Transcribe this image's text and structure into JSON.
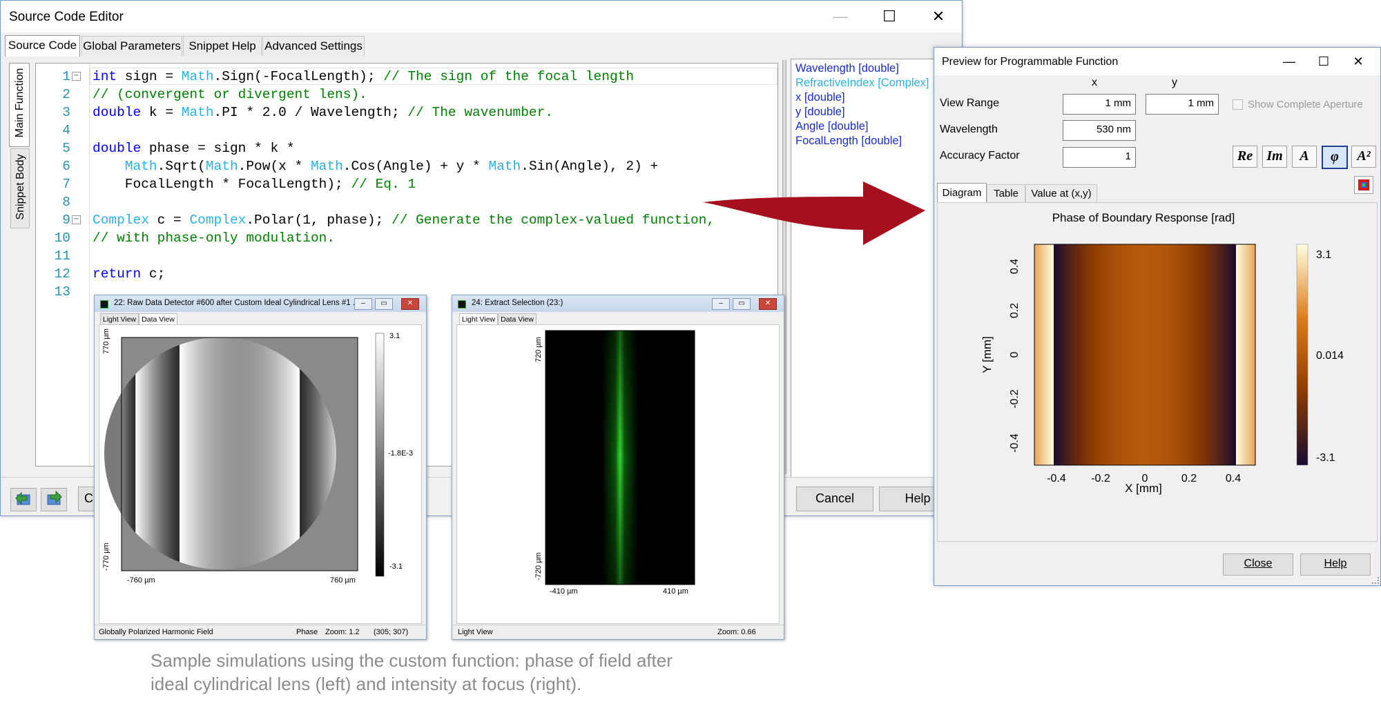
{
  "editor": {
    "title": "Source Code Editor",
    "tabs": [
      "Source Code",
      "Global Parameters",
      "Snippet Help",
      "Advanced Settings"
    ],
    "side_tabs": [
      "Main Function",
      "Snippet Body"
    ],
    "line_numbers": [
      "1",
      "2",
      "3",
      "4",
      "5",
      "6",
      "7",
      "8",
      "9",
      "10",
      "11",
      "12",
      "13"
    ],
    "code": {
      "l1": {
        "kw1": "int",
        "t1": " sign = ",
        "c1": "Math",
        "t2": ".Sign(-FocalLength); ",
        "cm": "// The sign of the focal length"
      },
      "l2": {
        "cm": "// (convergent or divergent lens)."
      },
      "l3": {
        "kw1": "double",
        "t1": " k = ",
        "c1": "Math",
        "t2": ".PI * 2.0 / Wavelength; ",
        "cm": "// The wavenumber."
      },
      "l5": {
        "kw1": "double",
        "t1": " phase = sign * k *"
      },
      "l6": {
        "t0": "    ",
        "c1": "Math",
        "t1": ".Sqrt(",
        "c2": "Math",
        "t2": ".Pow(x * ",
        "c3": "Math",
        "t3": ".Cos(Angle) + y * ",
        "c4": "Math",
        "t4": ".Sin(Angle), 2) +"
      },
      "l7": {
        "t1": "    FocalLength * FocalLength); ",
        "cm": "// Eq. 1"
      },
      "l9": {
        "c1": "Complex",
        "t1": " c = ",
        "c2": "Complex",
        "t2": ".Polar(1, phase); ",
        "cm": "// Generate the complex-valued function,"
      },
      "l10": {
        "cm": "// with phase-only modulation."
      },
      "l12": {
        "kw1": "return",
        "t1": " c;"
      }
    },
    "parameters": [
      "Wavelength [double]",
      "RefractiveIndex [Complex]",
      "x [double]",
      "y [double]",
      "Angle [double]",
      "FocalLength [double]"
    ],
    "cancel_label": "Cancel",
    "help_label": "Help",
    "partial_button_label": "C"
  },
  "preview": {
    "title": "Preview for Programmable Function",
    "col_x": "x",
    "col_y": "y",
    "view_range_label": "View Range",
    "view_range_x": "1 mm",
    "view_range_y": "1 mm",
    "show_complete_aperture": "Show Complete Aperture",
    "wavelength_label": "Wavelength",
    "wavelength_value": "530 nm",
    "accuracy_label": "Accuracy Factor",
    "accuracy_value": "1",
    "toolbar": [
      "Re",
      "Im",
      "A",
      "φ",
      "A²"
    ],
    "tabs": [
      "Diagram",
      "Table",
      "Value at (x,y)"
    ],
    "close_label": "Close",
    "help_label": "Help"
  },
  "chart_data": {
    "type": "heatmap",
    "title": "Phase of Boundary Response  [rad]",
    "xlabel": "X [mm]",
    "ylabel": "Y [mm]",
    "xlim": [
      -0.5,
      0.5
    ],
    "ylim": [
      -0.5,
      0.5
    ],
    "x_ticks": [
      "-0.4",
      "-0.2",
      "0",
      "0.2",
      "0.4"
    ],
    "y_ticks": [
      "0.4",
      "0.2",
      "0",
      "-0.2",
      "-0.4"
    ],
    "colorbar_ticks": [
      "3.1",
      "0.014",
      "-3.1"
    ],
    "colormap": [
      "#1a0b30",
      "#8c3a00",
      "#dd7a1a",
      "#ffffe0"
    ],
    "grid": false
  },
  "detector": {
    "title": "22: Raw Data Detector #600 after Custom Ideal Cylindrical Lens #1 ...",
    "tabs": [
      "Light View",
      "Data View"
    ],
    "y_top": "770 µm",
    "y_bottom": "-770 µm",
    "x_left": "-760 µm",
    "x_right": "760 µm",
    "cb_top": "3.1",
    "cb_mid": "-1.8E-3",
    "cb_bottom": "-3.1",
    "status_left": "Globally Polarized Harmonic Field",
    "status_phase": "Phase",
    "status_zoom": "Zoom: 1.2",
    "status_coords": "(305; 307)"
  },
  "extract": {
    "title": "24: Extract Selection (23:)",
    "tabs": [
      "Light View",
      "Data View"
    ],
    "y_top": "720 µm",
    "y_bottom": "-720 µm",
    "x_left": "-410 µm",
    "x_right": "410 µm",
    "status_left": "Light View",
    "status_zoom": "Zoom: 0.66"
  },
  "caption": {
    "line1": "Sample simulations using the custom function: phase of field after",
    "line2": "ideal cylindrical lens (left) and intensity at focus (right)."
  },
  "colors": {
    "arrow": "#a50f1e",
    "keyword": "#0000ff",
    "comment": "#008000",
    "class": "#2bb0e6"
  }
}
